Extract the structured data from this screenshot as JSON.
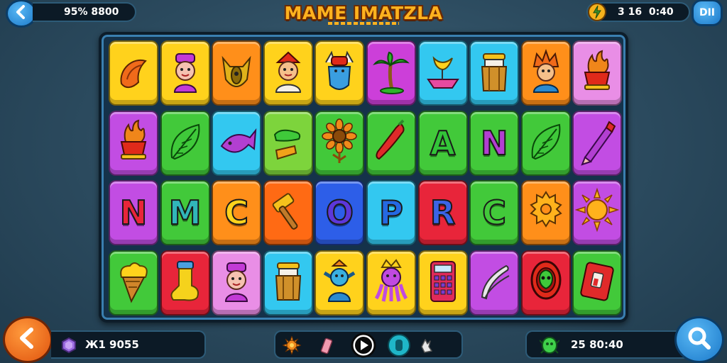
{
  "header": {
    "back_icon": "chevron-left-icon",
    "left_stat": "95% 8800",
    "title": "MAME IMATZLA",
    "right_stat": "3 16  0:40",
    "right_stat_icon": "bolt-coin-icon",
    "menu_label": "DII"
  },
  "board": {
    "columns": 10,
    "rows": 4,
    "tiles": [
      {
        "color": "#ffd21c",
        "icon": "croissant-icon"
      },
      {
        "color": "#ffd21c",
        "icon": "pink-character-icon"
      },
      {
        "color": "#ff8f1a",
        "icon": "horned-mask-icon"
      },
      {
        "color": "#ffd21c",
        "icon": "boy-red-hat-icon"
      },
      {
        "color": "#ffd21c",
        "icon": "viking-blue-beard-icon"
      },
      {
        "color": "#cc3fd9",
        "icon": "palm-tree-icon"
      },
      {
        "color": "#33c8f0",
        "icon": "banana-boat-icon"
      },
      {
        "color": "#33c8f0",
        "icon": "barrel-drum-icon"
      },
      {
        "color": "#ff8f1a",
        "icon": "orange-hair-boy-icon"
      },
      {
        "color": "#e98ee6",
        "icon": "fire-pot-icon"
      },
      {
        "color": "#c24de3",
        "icon": "fire-pot-icon"
      },
      {
        "color": "#42c93a",
        "icon": "green-leaf-icon"
      },
      {
        "color": "#33c8f0",
        "icon": "purple-fish-icon"
      },
      {
        "color": "#7dd43c",
        "icon": "pickle-icon"
      },
      {
        "color": "#42c93a",
        "icon": "sunflower-icon"
      },
      {
        "color": "#42c93a",
        "icon": "red-chili-icon"
      },
      {
        "color": "#42c93a",
        "letter": "A",
        "letter_color": "#32c438"
      },
      {
        "color": "#42c93a",
        "letter": "N",
        "letter_color": "#b23fd1"
      },
      {
        "color": "#42c93a",
        "icon": "green-leaf-icon"
      },
      {
        "color": "#c24de3",
        "icon": "crayon-icon"
      },
      {
        "color": "#c24de3",
        "letter": "N",
        "letter_color": "#e8253a"
      },
      {
        "color": "#42c93a",
        "letter": "M",
        "letter_color": "#31b6ba"
      },
      {
        "color": "#ff8f1a",
        "letter": "C",
        "letter_color": "#ffd21c"
      },
      {
        "color": "#ff6a14",
        "icon": "hammer-icon"
      },
      {
        "color": "#2d5ee8",
        "letter": "O",
        "letter_color": "#5d37d9"
      },
      {
        "color": "#33c8f0",
        "letter": "P",
        "letter_color": "#2569e3"
      },
      {
        "color": "#e8253a",
        "letter": "R",
        "letter_color": "#3a64e6"
      },
      {
        "color": "#42c93a",
        "letter": "C",
        "letter_color": "#42c93a"
      },
      {
        "color": "#ff8f1a",
        "icon": "gear-cog-icon"
      },
      {
        "color": "#c24de3",
        "icon": "sun-icon"
      },
      {
        "color": "#42c93a",
        "icon": "ice-cream-cone-icon"
      },
      {
        "color": "#e8253a",
        "icon": "sock-icon"
      },
      {
        "color": "#e98ee6",
        "icon": "pink-character-icon"
      },
      {
        "color": "#33c8f0",
        "icon": "barrel-drum-icon"
      },
      {
        "color": "#ffd21c",
        "icon": "blue-goblin-icon"
      },
      {
        "color": "#ffd21c",
        "icon": "purple-octopus-icon"
      },
      {
        "color": "#ffd21c",
        "icon": "calculator-icon"
      },
      {
        "color": "#c24de3",
        "icon": "cucumber-icon"
      },
      {
        "color": "#e8253a",
        "icon": "alien-badge-icon"
      },
      {
        "color": "#42c93a",
        "icon": "battery-card-icon"
      }
    ]
  },
  "footer": {
    "left_stat": "Ж1 9055",
    "left_stat_icon": "purple-gem-icon",
    "right_stat": "25 80:40",
    "right_stat_icon": "green-creature-icon",
    "back_icon": "chevron-left-icon",
    "search_icon": "search-icon",
    "center_icons": [
      "gear-sun-icon",
      "eraser-icon",
      "play-icon",
      "capsule-icon",
      "hand-icon"
    ]
  },
  "colors": {
    "accent_blue": "#1a78c9",
    "accent_orange": "#e0530e",
    "title_gold": "#ffb21e",
    "hud_bg": "#0c1a26"
  }
}
